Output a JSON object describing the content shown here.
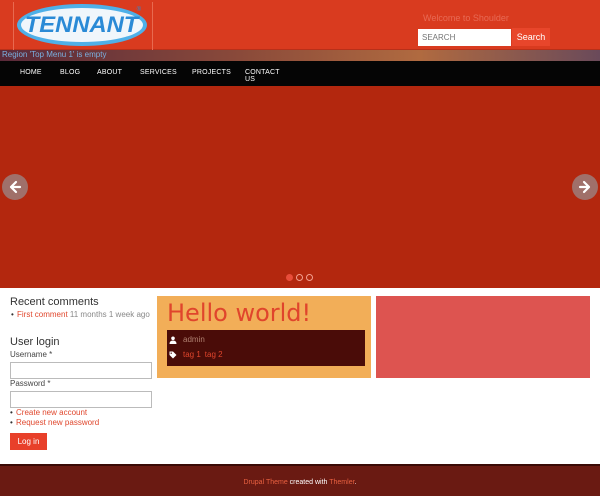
{
  "header": {
    "logo_text": "TENNANT",
    "logo_mark": "®",
    "welcome": "Welcome to Shoulder",
    "search_placeholder": "SEARCH",
    "search_button": "Search"
  },
  "region": {
    "text": "Region 'Top Menu 1' is empty"
  },
  "nav": {
    "items": [
      "HOME",
      "BLOG",
      "ABOUT",
      "SERVICES",
      "PROJECTS",
      "CONTACT US"
    ]
  },
  "slider": {
    "prev_icon": "arrow-left-icon",
    "next_icon": "arrow-right-icon",
    "slide_count": 3,
    "active_slide": 1
  },
  "sidebar": {
    "recent_comments_title": "Recent comments",
    "recent_comment_link": "First comment",
    "recent_comment_time": " 11 months 1 week ago",
    "user_login_title": "User login",
    "username_label": "Username",
    "password_label": "Password",
    "required_mark": "*",
    "create_account": "Create new account",
    "request_password": "Request new password",
    "login_button": "Log in"
  },
  "article": {
    "title": "Hello world!",
    "author": "admin",
    "tag1": "tag 1",
    "tag2": "tag 2"
  },
  "footer": {
    "link1": "Drupal Theme",
    "middle": " created with ",
    "link2": "Themler",
    "end": "."
  },
  "colors": {
    "header_bg": "#d93b1f",
    "slider_bg": "#b3270e",
    "accent": "#e0472d",
    "article_bg": "#f2ae58",
    "right_block_bg": "#dd5450",
    "footer_bg": "#6a1a12"
  }
}
